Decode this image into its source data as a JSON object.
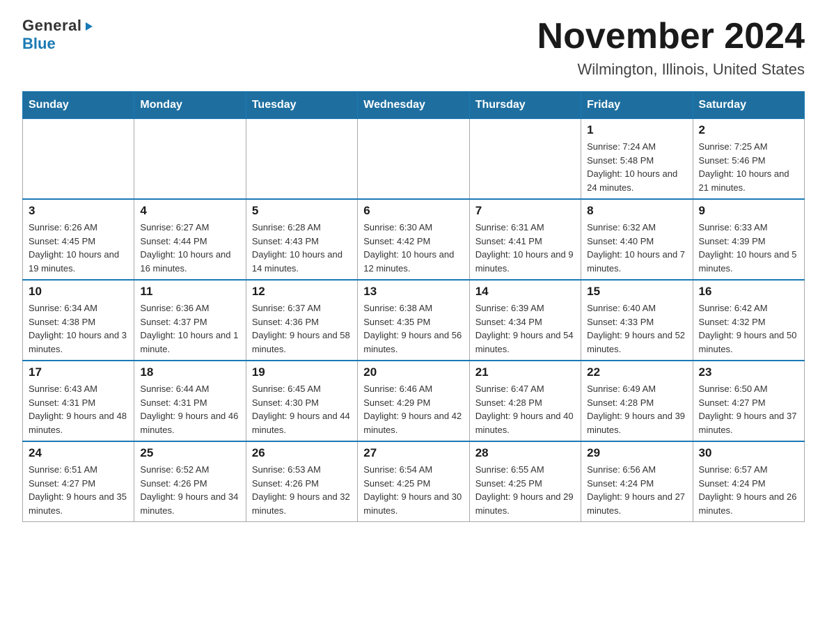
{
  "header": {
    "logo_general": "General",
    "logo_blue": "Blue",
    "title": "November 2024",
    "subtitle": "Wilmington, Illinois, United States"
  },
  "weekdays": [
    "Sunday",
    "Monday",
    "Tuesday",
    "Wednesday",
    "Thursday",
    "Friday",
    "Saturday"
  ],
  "weeks": [
    [
      {
        "day": "",
        "sunrise": "",
        "sunset": "",
        "daylight": ""
      },
      {
        "day": "",
        "sunrise": "",
        "sunset": "",
        "daylight": ""
      },
      {
        "day": "",
        "sunrise": "",
        "sunset": "",
        "daylight": ""
      },
      {
        "day": "",
        "sunrise": "",
        "sunset": "",
        "daylight": ""
      },
      {
        "day": "",
        "sunrise": "",
        "sunset": "",
        "daylight": ""
      },
      {
        "day": "1",
        "sunrise": "Sunrise: 7:24 AM",
        "sunset": "Sunset: 5:48 PM",
        "daylight": "Daylight: 10 hours and 24 minutes."
      },
      {
        "day": "2",
        "sunrise": "Sunrise: 7:25 AM",
        "sunset": "Sunset: 5:46 PM",
        "daylight": "Daylight: 10 hours and 21 minutes."
      }
    ],
    [
      {
        "day": "3",
        "sunrise": "Sunrise: 6:26 AM",
        "sunset": "Sunset: 4:45 PM",
        "daylight": "Daylight: 10 hours and 19 minutes."
      },
      {
        "day": "4",
        "sunrise": "Sunrise: 6:27 AM",
        "sunset": "Sunset: 4:44 PM",
        "daylight": "Daylight: 10 hours and 16 minutes."
      },
      {
        "day": "5",
        "sunrise": "Sunrise: 6:28 AM",
        "sunset": "Sunset: 4:43 PM",
        "daylight": "Daylight: 10 hours and 14 minutes."
      },
      {
        "day": "6",
        "sunrise": "Sunrise: 6:30 AM",
        "sunset": "Sunset: 4:42 PM",
        "daylight": "Daylight: 10 hours and 12 minutes."
      },
      {
        "day": "7",
        "sunrise": "Sunrise: 6:31 AM",
        "sunset": "Sunset: 4:41 PM",
        "daylight": "Daylight: 10 hours and 9 minutes."
      },
      {
        "day": "8",
        "sunrise": "Sunrise: 6:32 AM",
        "sunset": "Sunset: 4:40 PM",
        "daylight": "Daylight: 10 hours and 7 minutes."
      },
      {
        "day": "9",
        "sunrise": "Sunrise: 6:33 AM",
        "sunset": "Sunset: 4:39 PM",
        "daylight": "Daylight: 10 hours and 5 minutes."
      }
    ],
    [
      {
        "day": "10",
        "sunrise": "Sunrise: 6:34 AM",
        "sunset": "Sunset: 4:38 PM",
        "daylight": "Daylight: 10 hours and 3 minutes."
      },
      {
        "day": "11",
        "sunrise": "Sunrise: 6:36 AM",
        "sunset": "Sunset: 4:37 PM",
        "daylight": "Daylight: 10 hours and 1 minute."
      },
      {
        "day": "12",
        "sunrise": "Sunrise: 6:37 AM",
        "sunset": "Sunset: 4:36 PM",
        "daylight": "Daylight: 9 hours and 58 minutes."
      },
      {
        "day": "13",
        "sunrise": "Sunrise: 6:38 AM",
        "sunset": "Sunset: 4:35 PM",
        "daylight": "Daylight: 9 hours and 56 minutes."
      },
      {
        "day": "14",
        "sunrise": "Sunrise: 6:39 AM",
        "sunset": "Sunset: 4:34 PM",
        "daylight": "Daylight: 9 hours and 54 minutes."
      },
      {
        "day": "15",
        "sunrise": "Sunrise: 6:40 AM",
        "sunset": "Sunset: 4:33 PM",
        "daylight": "Daylight: 9 hours and 52 minutes."
      },
      {
        "day": "16",
        "sunrise": "Sunrise: 6:42 AM",
        "sunset": "Sunset: 4:32 PM",
        "daylight": "Daylight: 9 hours and 50 minutes."
      }
    ],
    [
      {
        "day": "17",
        "sunrise": "Sunrise: 6:43 AM",
        "sunset": "Sunset: 4:31 PM",
        "daylight": "Daylight: 9 hours and 48 minutes."
      },
      {
        "day": "18",
        "sunrise": "Sunrise: 6:44 AM",
        "sunset": "Sunset: 4:31 PM",
        "daylight": "Daylight: 9 hours and 46 minutes."
      },
      {
        "day": "19",
        "sunrise": "Sunrise: 6:45 AM",
        "sunset": "Sunset: 4:30 PM",
        "daylight": "Daylight: 9 hours and 44 minutes."
      },
      {
        "day": "20",
        "sunrise": "Sunrise: 6:46 AM",
        "sunset": "Sunset: 4:29 PM",
        "daylight": "Daylight: 9 hours and 42 minutes."
      },
      {
        "day": "21",
        "sunrise": "Sunrise: 6:47 AM",
        "sunset": "Sunset: 4:28 PM",
        "daylight": "Daylight: 9 hours and 40 minutes."
      },
      {
        "day": "22",
        "sunrise": "Sunrise: 6:49 AM",
        "sunset": "Sunset: 4:28 PM",
        "daylight": "Daylight: 9 hours and 39 minutes."
      },
      {
        "day": "23",
        "sunrise": "Sunrise: 6:50 AM",
        "sunset": "Sunset: 4:27 PM",
        "daylight": "Daylight: 9 hours and 37 minutes."
      }
    ],
    [
      {
        "day": "24",
        "sunrise": "Sunrise: 6:51 AM",
        "sunset": "Sunset: 4:27 PM",
        "daylight": "Daylight: 9 hours and 35 minutes."
      },
      {
        "day": "25",
        "sunrise": "Sunrise: 6:52 AM",
        "sunset": "Sunset: 4:26 PM",
        "daylight": "Daylight: 9 hours and 34 minutes."
      },
      {
        "day": "26",
        "sunrise": "Sunrise: 6:53 AM",
        "sunset": "Sunset: 4:26 PM",
        "daylight": "Daylight: 9 hours and 32 minutes."
      },
      {
        "day": "27",
        "sunrise": "Sunrise: 6:54 AM",
        "sunset": "Sunset: 4:25 PM",
        "daylight": "Daylight: 9 hours and 30 minutes."
      },
      {
        "day": "28",
        "sunrise": "Sunrise: 6:55 AM",
        "sunset": "Sunset: 4:25 PM",
        "daylight": "Daylight: 9 hours and 29 minutes."
      },
      {
        "day": "29",
        "sunrise": "Sunrise: 6:56 AM",
        "sunset": "Sunset: 4:24 PM",
        "daylight": "Daylight: 9 hours and 27 minutes."
      },
      {
        "day": "30",
        "sunrise": "Sunrise: 6:57 AM",
        "sunset": "Sunset: 4:24 PM",
        "daylight": "Daylight: 9 hours and 26 minutes."
      }
    ]
  ]
}
